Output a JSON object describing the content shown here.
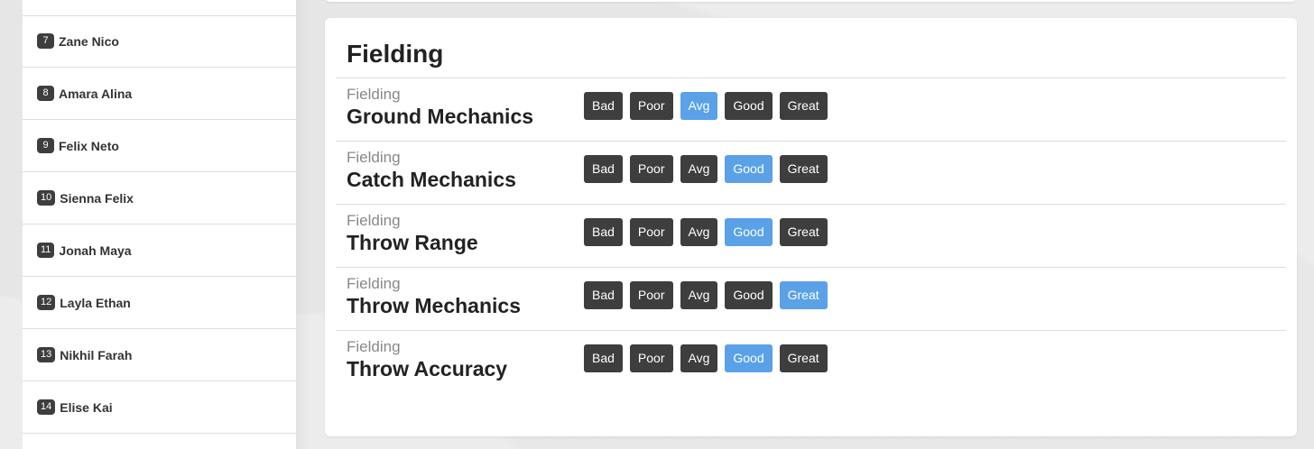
{
  "sidebar": {
    "players": [
      {
        "number": "7",
        "name": "Zane Nico"
      },
      {
        "number": "8",
        "name": "Amara Alina"
      },
      {
        "number": "9",
        "name": "Felix Neto"
      },
      {
        "number": "10",
        "name": "Sienna Felix"
      },
      {
        "number": "11",
        "name": "Jonah Maya"
      },
      {
        "number": "12",
        "name": "Layla Ethan"
      },
      {
        "number": "13",
        "name": "Nikhil Farah"
      },
      {
        "number": "14",
        "name": "Elise Kai"
      }
    ]
  },
  "main": {
    "title": "Fielding",
    "rating_labels": [
      "Bad",
      "Poor",
      "Avg",
      "Good",
      "Great"
    ],
    "skills": [
      {
        "category": "Fielding",
        "name": "Ground Mechanics",
        "selected": "Avg"
      },
      {
        "category": "Fielding",
        "name": "Catch Mechanics",
        "selected": "Good"
      },
      {
        "category": "Fielding",
        "name": "Throw Range",
        "selected": "Good"
      },
      {
        "category": "Fielding",
        "name": "Throw Mechanics",
        "selected": "Great"
      },
      {
        "category": "Fielding",
        "name": "Throw Accuracy",
        "selected": "Good"
      }
    ]
  },
  "colors": {
    "selected": "#5aa1e8",
    "button": "#3e3e3e",
    "badge": "#3e3e3e"
  }
}
